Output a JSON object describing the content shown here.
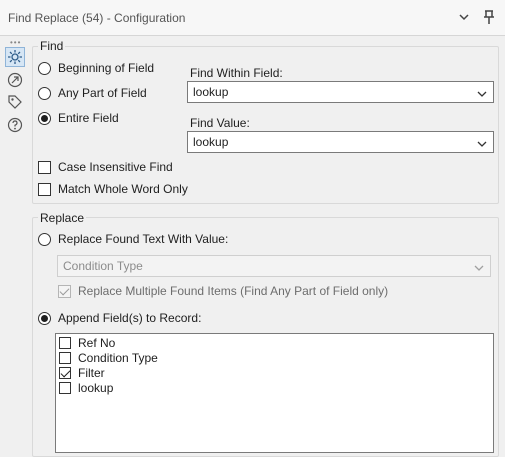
{
  "window": {
    "title": "Find Replace (54) - Configuration"
  },
  "find": {
    "group_label": "Find",
    "options": [
      {
        "label": "Beginning of Field",
        "selected": false
      },
      {
        "label": "Any Part of Field",
        "selected": false
      },
      {
        "label": "Entire Field",
        "selected": true
      }
    ],
    "find_within_label": "Find Within Field:",
    "find_within_value": "lookup",
    "find_value_label": "Find Value:",
    "find_value_value": "lookup",
    "case_insensitive_label": "Case Insensitive Find",
    "case_insensitive_checked": false,
    "whole_word_label": "Match Whole Word Only",
    "whole_word_checked": false
  },
  "replace": {
    "group_label": "Replace",
    "replace_found_label": "Replace Found Text With Value:",
    "replace_found_selected": false,
    "replace_value": "Condition Type",
    "replace_multiple_label": "Replace Multiple Found Items (Find Any Part of Field only)",
    "replace_multiple_checked": true,
    "append_label": "Append Field(s) to Record:",
    "append_selected": true,
    "fields": [
      {
        "label": "Ref No",
        "checked": false
      },
      {
        "label": "Condition Type",
        "checked": false
      },
      {
        "label": "Filter",
        "checked": true
      },
      {
        "label": "lookup",
        "checked": false
      }
    ]
  },
  "icons": [
    "gear-icon",
    "connection-icon",
    "tag-icon",
    "help-icon",
    "chevron-down-icon",
    "pin-icon"
  ],
  "colors": {
    "background": "#f0f0f0",
    "active_tab": "#d6e6f5"
  }
}
